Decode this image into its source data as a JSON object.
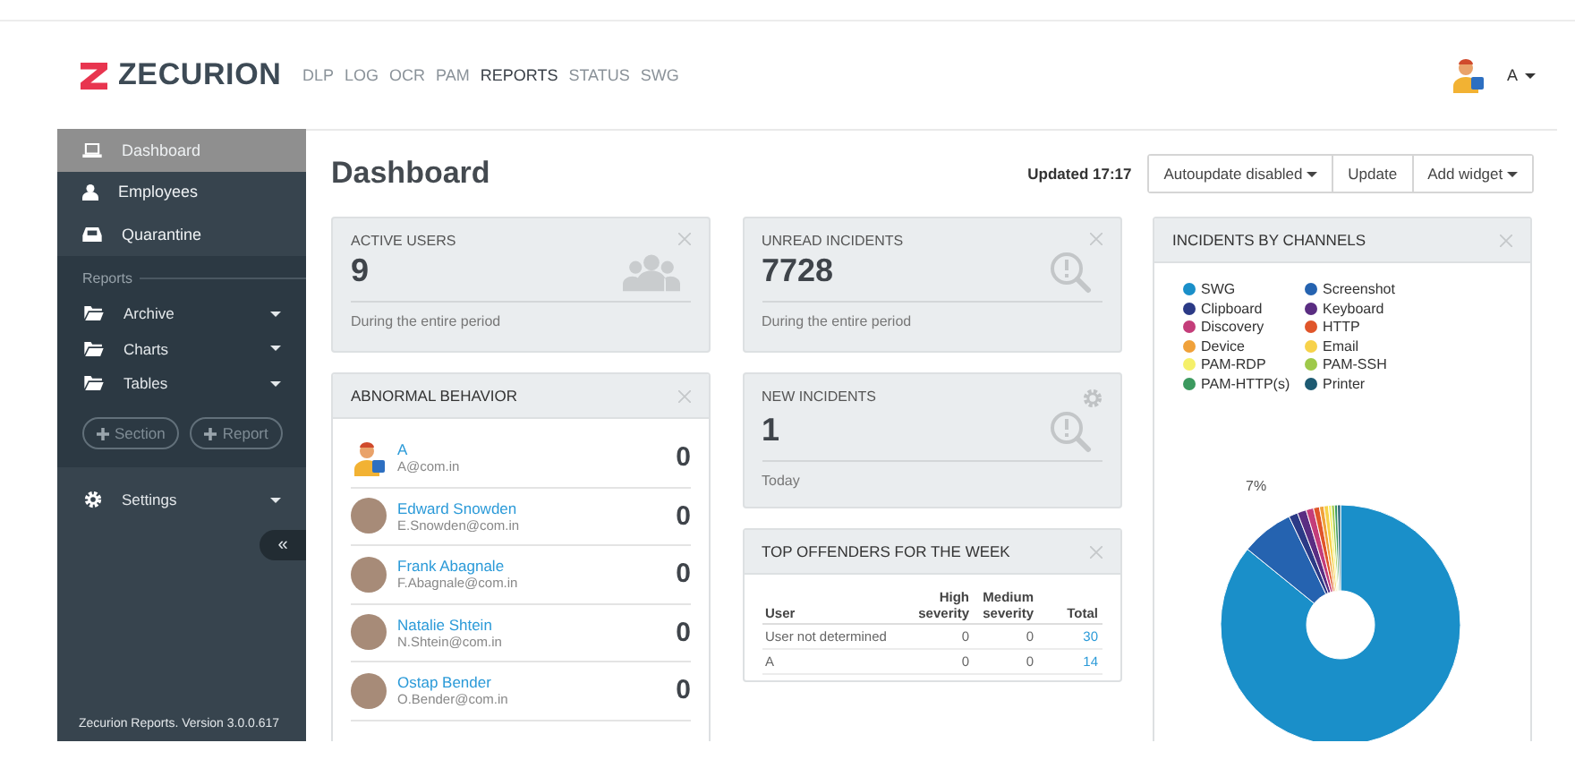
{
  "header": {
    "logo": "ZECURION",
    "nav": [
      {
        "label": "DLP",
        "selected": false
      },
      {
        "label": "LOG",
        "selected": false
      },
      {
        "label": "OCR",
        "selected": false
      },
      {
        "label": "PAM",
        "selected": false
      },
      {
        "label": "REPORTS",
        "selected": true
      },
      {
        "label": "STATUS",
        "selected": false
      },
      {
        "label": "SWG",
        "selected": false
      }
    ],
    "user": "A"
  },
  "sidebar": {
    "items": [
      {
        "label": "Dashboard",
        "kind": "laptop",
        "selected": true
      },
      {
        "label": "Employees",
        "kind": "user",
        "selected": false
      },
      {
        "label": "Quarantine",
        "kind": "inbox",
        "selected": false
      }
    ],
    "section_title": "Reports",
    "report_items": [
      {
        "label": "Archive"
      },
      {
        "label": "Charts"
      },
      {
        "label": "Tables"
      }
    ],
    "add_buttons": [
      "Section",
      "Report"
    ],
    "settings": "Settings",
    "collapse": "«",
    "version": "Zecurion Reports. Version 3.0.0.617"
  },
  "page": {
    "title": "Dashboard",
    "updated": "Updated 17:17",
    "buttons": [
      {
        "label": "Autoupdate disabled",
        "dropdown": true
      },
      {
        "label": "Update",
        "dropdown": false
      },
      {
        "label": "Add widget",
        "dropdown": true
      }
    ]
  },
  "active_users": {
    "title": "ACTIVE USERS",
    "value": "9",
    "note": "During the entire period",
    "kind": "users",
    "closable": true,
    "configurable": false
  },
  "abnormal_behavior": {
    "title": "ABNORMAL BEHAVIOR",
    "rows": [
      {
        "name": "A",
        "email": "A@com.in",
        "count": "0",
        "kind": "cartoon"
      },
      {
        "name": "Edward Snowden",
        "email": "E.Snowden@com.in",
        "count": "0",
        "kind": "photo"
      },
      {
        "name": "Frank Abagnale",
        "email": "F.Abagnale@com.in",
        "count": "0",
        "kind": "photo"
      },
      {
        "name": "Natalie Shtein",
        "email": "N.Shtein@com.in",
        "count": "0",
        "kind": "photo"
      },
      {
        "name": "Ostap Bender",
        "email": "O.Bender@com.in",
        "count": "0",
        "kind": "photo"
      }
    ]
  },
  "unread_incidents": {
    "title": "UNREAD INCIDENTS",
    "value": "7728",
    "note": "During the entire period",
    "kind": "search",
    "closable": true,
    "configurable": false
  },
  "new_incidents": {
    "title": "NEW INCIDENTS",
    "value": "1",
    "note": "Today",
    "kind": "search",
    "closable": false,
    "configurable": true
  },
  "top_offenders": {
    "title": "TOP OFFENDERS FOR THE WEEK",
    "columns": [
      "User",
      "High severity",
      "Medium severity",
      "Total"
    ],
    "rows": [
      [
        "User not determined",
        "0",
        "0",
        "30"
      ],
      [
        "A",
        "0",
        "0",
        "14"
      ]
    ]
  },
  "incidents_by_channels": {
    "title": "INCIDENTS BY CHANNELS",
    "legend": [
      {
        "label": "SWG",
        "color": "#1a8fc9"
      },
      {
        "label": "Screenshot",
        "color": "#2563b0"
      },
      {
        "label": "Clipboard",
        "color": "#2b3a86"
      },
      {
        "label": "Keyboard",
        "color": "#5a2d82"
      },
      {
        "label": "Discovery",
        "color": "#c43d7a"
      },
      {
        "label": "HTTP",
        "color": "#e0552a"
      },
      {
        "label": "Device",
        "color": "#f0a13a"
      },
      {
        "label": "Email",
        "color": "#f7d24a"
      },
      {
        "label": "PAM-RDP",
        "color": "#f5f06a"
      },
      {
        "label": "PAM-SSH",
        "color": "#9ec94a"
      },
      {
        "label": "PAM-HTTP(s)",
        "color": "#3c9a5f"
      },
      {
        "label": "Printer",
        "color": "#1d5a72"
      }
    ],
    "slice_label": "7%"
  }
}
